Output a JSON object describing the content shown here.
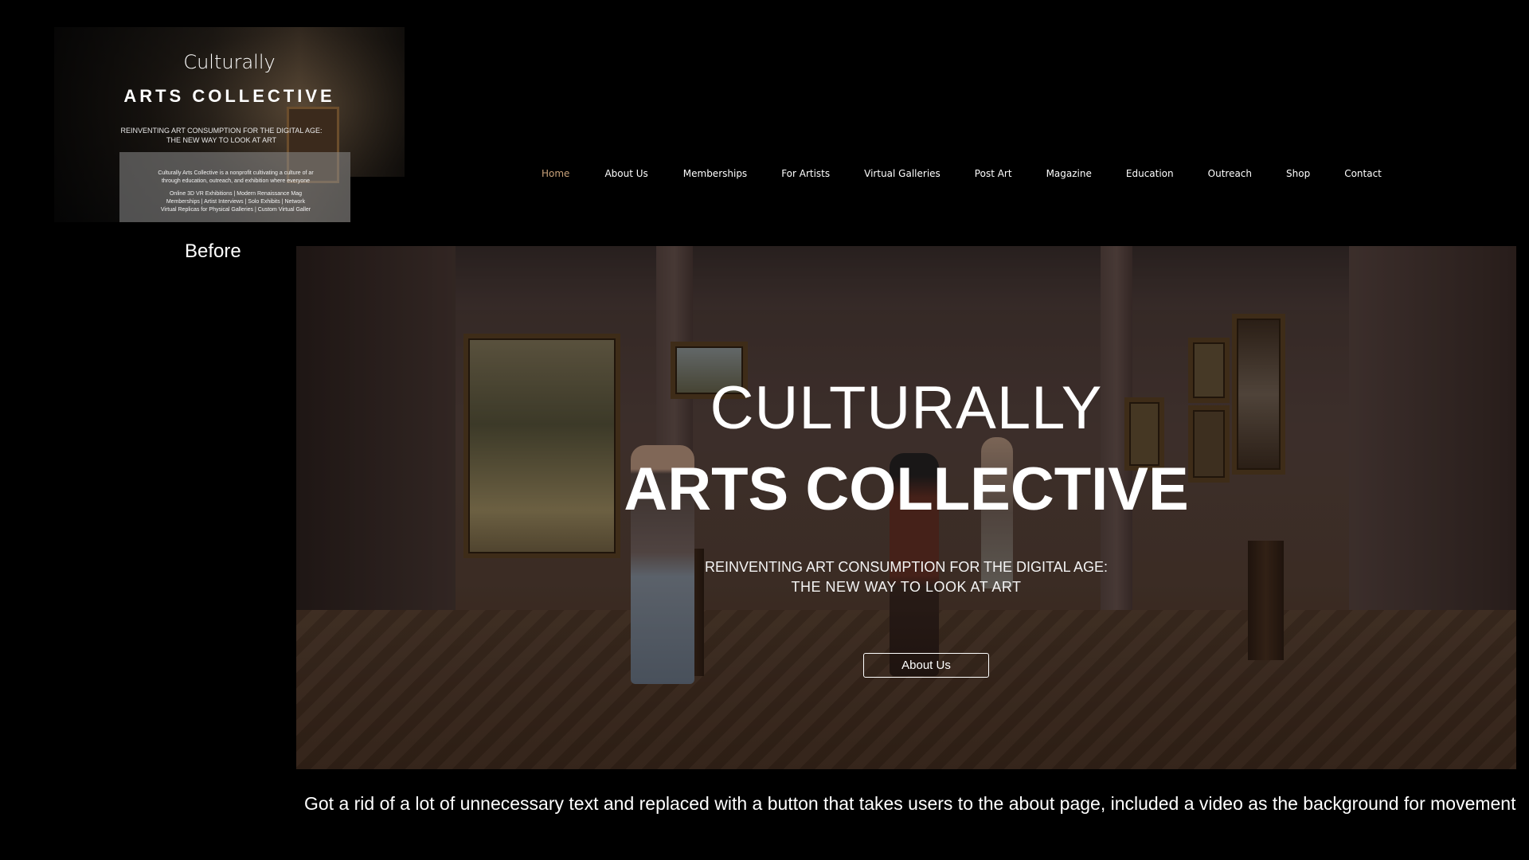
{
  "before": {
    "title_script": "Culturally",
    "title_main": "ARTS COLLECTIVE",
    "tagline_line1": "REINVENTING ART CONSUMPTION FOR THE DIGITAL AGE:",
    "tagline_line2": "THE NEW WAY TO LOOK AT ART",
    "panel_lines": [
      "Culturally Arts Collective is a nonprofit cultivating a culture of ar",
      "through education, outreach, and exhibition where everyone",
      "Online 3D VR Exhibitions | Modern Renaissance Mag",
      "Memberships | Artist Interviews | Solo Exhibits | Network",
      "Virtual Replicas for Physical Galleries | Custom Virtual Galler"
    ],
    "label": "Before"
  },
  "nav": {
    "items": [
      {
        "label": "Home",
        "active": true
      },
      {
        "label": "About Us"
      },
      {
        "label": "Memberships"
      },
      {
        "label": "For Artists"
      },
      {
        "label": "Virtual Galleries"
      },
      {
        "label": "Post Art"
      },
      {
        "label": "Magazine"
      },
      {
        "label": "Education"
      },
      {
        "label": "Outreach"
      },
      {
        "label": "Shop"
      },
      {
        "label": "Contact"
      }
    ]
  },
  "hero": {
    "title_line1": "CULTURALLY",
    "title_line2": "ARTS COLLECTIVE",
    "tagline_line1": "REINVENTING ART CONSUMPTION FOR THE DIGITAL AGE:",
    "tagline_line2": "THE NEW WAY TO LOOK AT ART",
    "button_label": "About Us"
  },
  "caption": "Got a rid of a lot of unnecessary text and replaced with a button that takes users to the about page, included a video as the background for movement",
  "colors": {
    "background": "#000000",
    "nav_active": "#c9a27a",
    "text": "#ffffff"
  }
}
